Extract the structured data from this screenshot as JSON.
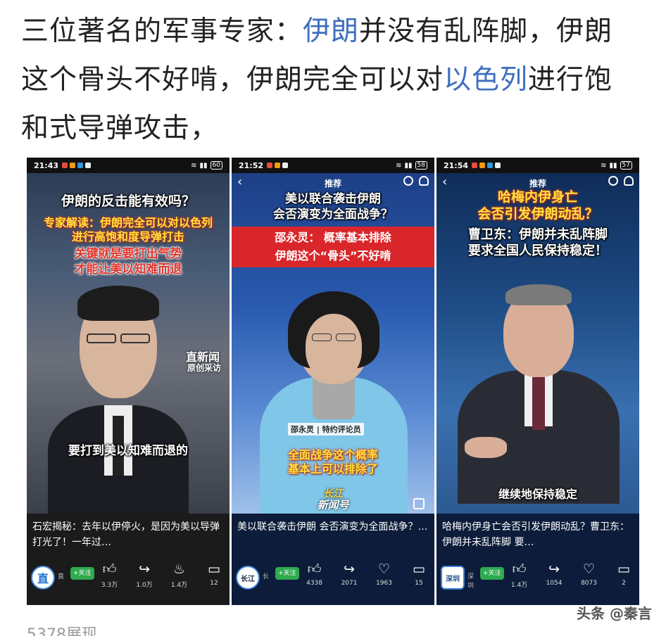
{
  "headline": {
    "part1": "三位著名的军事专家：",
    "tag1": "伊朗",
    "part2": "并没有乱阵脚，伊朗这个骨头不好啃，伊朗完全可以对",
    "tag2": "以色列",
    "part3": "进行饱和式导弹攻击，"
  },
  "phones": [
    {
      "time": "21:43",
      "battery": "60",
      "title": "伊朗的反击能有效吗？",
      "sub1": "专家解读：伊朗完全可以对以色列",
      "sub2": "进行高饱和度导弹打击",
      "sub3": "关键就是要打出气势",
      "sub4": "才能让美以知难而退",
      "logo1": "直新闻",
      "logo2": "原创采访",
      "subtitle": "要打到美以知难而退的",
      "caption": "石宏揭秘：去年以伊停火，是因为美以导弹打光了！一年过…",
      "avatar": "直",
      "author": "直",
      "follow": "+关注",
      "counts": [
        "3.3万",
        "1.0万",
        "1.4万",
        "12"
      ]
    },
    {
      "time": "21:52",
      "battery": "58",
      "recommend": "推荐",
      "title1": "美以联合袭击伊朗",
      "title2": "会否演变为全面战争？",
      "banner1": "邵永灵：  概率基本排除",
      "banner2": "伊朗这个“骨头”不好啃",
      "nameplate": "邵永灵 | 特约评论员",
      "subtitle1": "全面战争这个概率",
      "subtitle2": "基本上可以排除了",
      "logo1": "长江",
      "logo2": "新闻号",
      "caption": "美以联合袭击伊朗 会否演变为全面战争？…",
      "avatar": "长江",
      "author": "长",
      "follow": "+关注",
      "counts": [
        "4338",
        "2071",
        "1963",
        "15"
      ]
    },
    {
      "time": "21:54",
      "battery": "57",
      "recommend": "推荐",
      "title1": "哈梅内伊身亡",
      "title2": "会否引发伊朗动乱？",
      "sub1": "曹卫东：伊朗并未乱阵脚",
      "sub2": "要求全国人民保持稳定！",
      "subtitle": "继续地保持稳定",
      "caption": "哈梅内伊身亡会否引发伊朗动乱？曹卫东：伊朗并未乱阵脚 要…",
      "avatar": "深圳",
      "author": "深圳",
      "follow": "+关注",
      "counts": [
        "1.4万",
        "1054",
        "8073",
        "2"
      ]
    }
  ],
  "views": "5378展现",
  "watermark": "头条 @秦言"
}
